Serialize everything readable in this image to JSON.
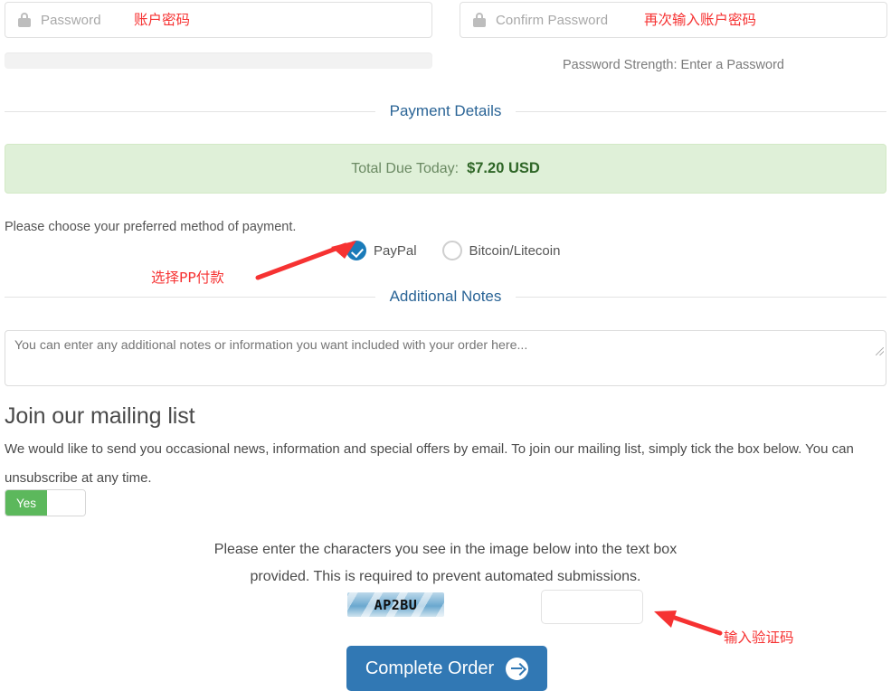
{
  "password": {
    "placeholder": "Password",
    "lock_icon": "lock-icon",
    "note_zh": "账户密码",
    "confirm_placeholder": "Confirm Password",
    "confirm_note_zh": "再次输入账户密码",
    "strength_text": "Password Strength: Enter a Password"
  },
  "payment": {
    "section_title": "Payment Details",
    "total_label": "Total Due Today:",
    "total_amount": "$7.20 USD",
    "prompt": "Please choose your preferred method of payment.",
    "note_zh": "选择PP付款",
    "methods": [
      {
        "label": "PayPal",
        "selected": true
      },
      {
        "label": "Bitcoin/Litecoin",
        "selected": false
      }
    ]
  },
  "notes": {
    "section_title": "Additional Notes",
    "placeholder": "You can enter any additional notes or information you want included with your order here...",
    "value": ""
  },
  "mailing": {
    "title": "Join our mailing list",
    "body": "We would like to send you occasional news, information and special offers by email. To join our mailing list, simply tick the box below. You can unsubscribe at any time.",
    "toggle_on_label": "Yes",
    "toggle_state": "on"
  },
  "captcha": {
    "instructions_line1": "Please enter the characters you see in the image below into the text box",
    "instructions_line2": "provided. This is required to prevent automated submissions.",
    "image_code": "AP2BU",
    "input_value": "",
    "note_zh": "输入验证码"
  },
  "submit": {
    "label": "Complete Order",
    "icon": "arrow-right-circle-icon"
  },
  "colors": {
    "accent_blue": "#3178b4",
    "section_title_blue": "#2a6496",
    "success_bg": "#dff0d8",
    "success_text": "#2f6627",
    "toggle_green": "#5cb85c",
    "annotation_red": "#f63232"
  }
}
